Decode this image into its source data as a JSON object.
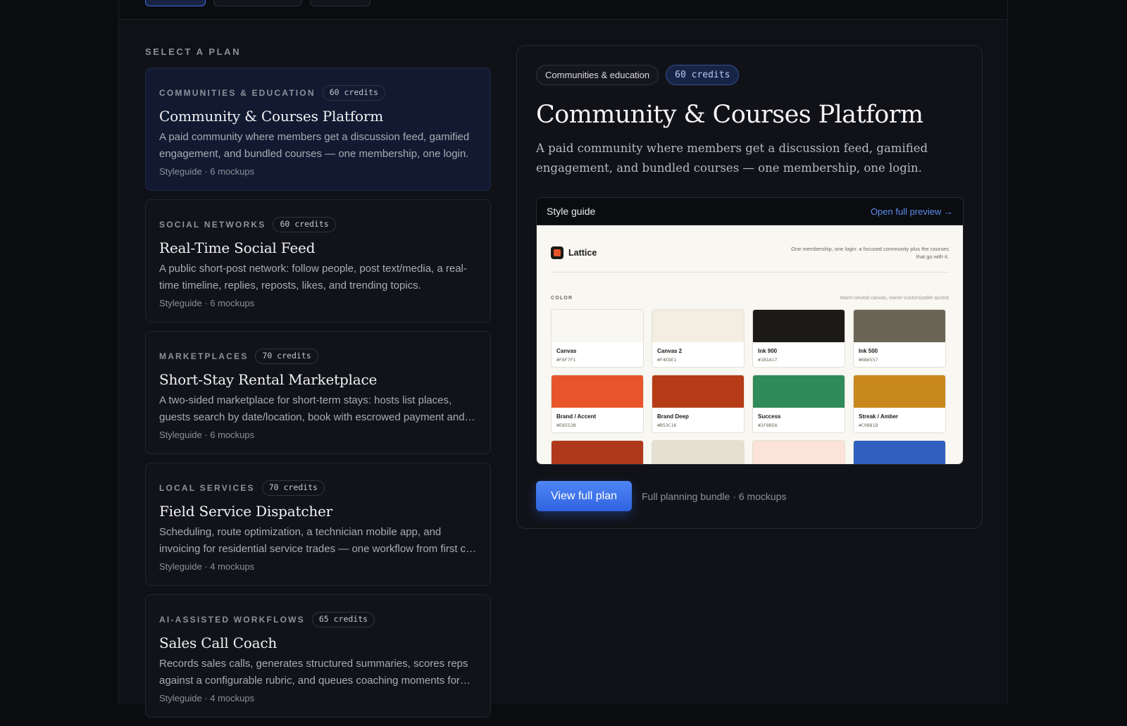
{
  "section_label": "SELECT A PLAN",
  "plans": [
    {
      "category": "COMMUNITIES & EDUCATION",
      "credits": "60 credits",
      "title": "Community & Courses Platform",
      "description": "A paid community where members get a discussion feed, gamified engagement, and bundled courses — one membership, one login.",
      "meta": "Styleguide · 6 mockups",
      "selected": true
    },
    {
      "category": "SOCIAL NETWORKS",
      "credits": "60 credits",
      "title": "Real-Time Social Feed",
      "description": "A public short-post network: follow people, post text/media, a real-time timeline, replies, reposts, likes, and trending topics.",
      "meta": "Styleguide · 6 mockups",
      "selected": false
    },
    {
      "category": "MARKETPLACES",
      "credits": "70 credits",
      "title": "Short-Stay Rental Marketplace",
      "description": "A two-sided marketplace for short-term stays: hosts list places, guests search by date/location, book with escrowed payment and reviews.",
      "meta": "Styleguide · 6 mockups",
      "selected": false
    },
    {
      "category": "LOCAL SERVICES",
      "credits": "70 credits",
      "title": "Field Service Dispatcher",
      "description": "Scheduling, route optimization, a technician mobile app, and invoicing for residential service trades — one workflow from first call to paid.",
      "meta": "Styleguide · 4 mockups",
      "selected": false
    },
    {
      "category": "AI-ASSISTED WORKFLOWS",
      "credits": "65 credits",
      "title": "Sales Call Coach",
      "description": "Records sales calls, generates structured summaries, scores reps against a configurable rubric, and queues coaching moments for managers.",
      "meta": "Styleguide · 4 mockups",
      "selected": false
    }
  ],
  "detail": {
    "category_chip": "Communities & education",
    "credits_chip": "60 credits",
    "title": "Community & Courses Platform",
    "description": "A paid community where members get a discussion feed, gamified engagement, and bundled courses — one membership, one login.",
    "preview_label": "Style guide",
    "preview_link": "Open full preview →",
    "cta_label": "View full plan",
    "footer_meta": "Full planning bundle · 6 mockups"
  },
  "styleguide": {
    "brand_name": "Lattice",
    "tagline": "One membership, one login: a focused community plus the courses that go with it.",
    "section_title": "COLOR",
    "section_note": "Warm neutral canvas, owner-customizable accent",
    "swatches": [
      {
        "name": "Canvas",
        "hex": "#F8F7F1",
        "color": "#F8F7F1"
      },
      {
        "name": "Canvas 2",
        "hex": "#F4EDE1",
        "color": "#F4EDE1"
      },
      {
        "name": "Ink 900",
        "hex": "#1B1A17",
        "color": "#1B1A17"
      },
      {
        "name": "Ink 500",
        "hex": "#6B6557",
        "color": "#6B6557"
      },
      {
        "name": "Brand / Accent",
        "hex": "#E8552B",
        "color": "#E8552B"
      },
      {
        "name": "Brand Deep",
        "hex": "#B53C16",
        "color": "#B53C16"
      },
      {
        "name": "Success",
        "hex": "#2F8B5A",
        "color": "#2F8B5A"
      },
      {
        "name": "Streak / Amber",
        "hex": "#C9881D",
        "color": "#C9881D"
      },
      {
        "name": "",
        "hex": "",
        "color": "#B0391B"
      },
      {
        "name": "",
        "hex": "",
        "color": "#E6E0D1"
      },
      {
        "name": "",
        "hex": "",
        "color": "#FCE3D9"
      },
      {
        "name": "",
        "hex": "",
        "color": "#2F5FBF"
      }
    ]
  },
  "colors": {
    "accent": "#3D6FE0",
    "page_bg": "#0B0C10",
    "panel_bg": "#101116"
  }
}
